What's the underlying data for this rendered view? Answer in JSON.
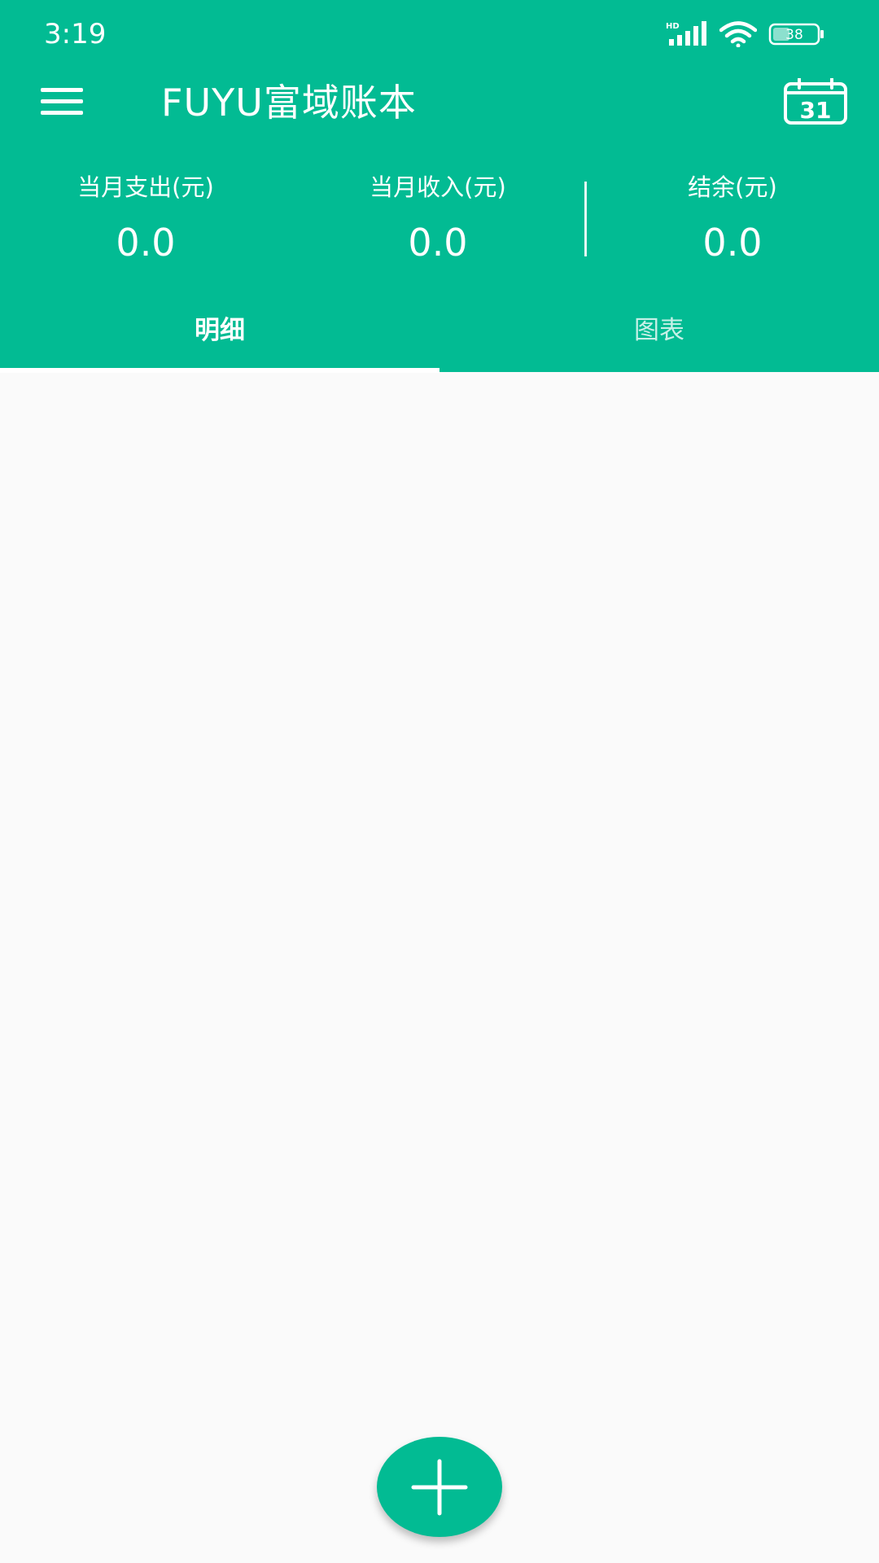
{
  "status_bar": {
    "time": "3:19",
    "network_label": "HD",
    "battery_level": "38",
    "icons": [
      "signal-icon",
      "wifi-icon",
      "battery-icon"
    ]
  },
  "toolbar": {
    "title": "FUYU富域账本",
    "menu_icon": "menu-icon",
    "calendar_icon": "calendar-icon",
    "calendar_day": "31"
  },
  "summary": {
    "expense_label": "当月支出(元)",
    "expense_value": "0.0",
    "income_label": "当月收入(元)",
    "income_value": "0.0",
    "balance_label": "结余(元)",
    "balance_value": "0.0"
  },
  "tabs": [
    {
      "label": "明细",
      "active": true
    },
    {
      "label": "图表",
      "active": false
    }
  ],
  "fab": {
    "icon": "plus-icon"
  },
  "colors": {
    "primary": "#02bb93",
    "background": "#fafafa",
    "on_primary": "#ffffff"
  }
}
